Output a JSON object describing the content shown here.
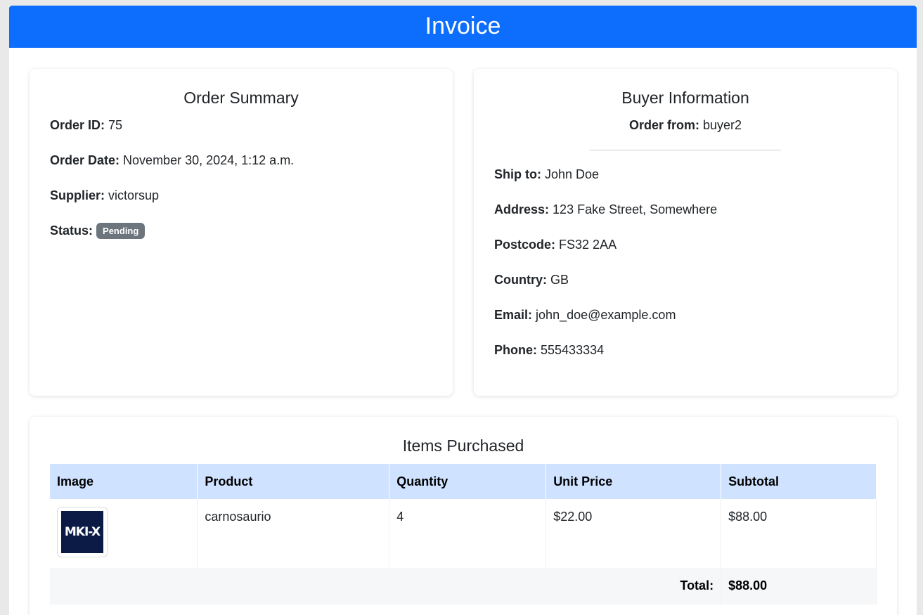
{
  "header": {
    "title": "Invoice"
  },
  "summary": {
    "title": "Order Summary",
    "order_id_label": "Order ID:",
    "order_id": "75",
    "order_date_label": "Order Date:",
    "order_date": "November 30, 2024, 1:12 a.m.",
    "supplier_label": "Supplier:",
    "supplier": "victorsup",
    "status_label": "Status:",
    "status": "Pending",
    "status_color": "#6c757d"
  },
  "buyer": {
    "title": "Buyer Information",
    "order_from_label": "Order from:",
    "order_from": "buyer2",
    "ship_to_label": "Ship to:",
    "ship_to": "John Doe",
    "address_label": "Address:",
    "address": "123 Fake Street, Somewhere",
    "postcode_label": "Postcode:",
    "postcode": "FS32 2AA",
    "country_label": "Country:",
    "country": "GB",
    "email_label": "Email:",
    "email": "john_doe@example.com",
    "phone_label": "Phone:",
    "phone": "555433334"
  },
  "items": {
    "title": "Items Purchased",
    "columns": [
      "Image",
      "Product",
      "Quantity",
      "Unit Price",
      "Subtotal"
    ],
    "rows": [
      {
        "image_text": "MKI-X",
        "product": "carnosaurio",
        "quantity": "4",
        "unit_price": "$22.00",
        "subtotal": "$88.00"
      }
    ],
    "total_label": "Total:",
    "total": "$88.00"
  },
  "colors": {
    "header_bg": "#0d6efd",
    "table_header_bg": "#cfe2ff"
  }
}
